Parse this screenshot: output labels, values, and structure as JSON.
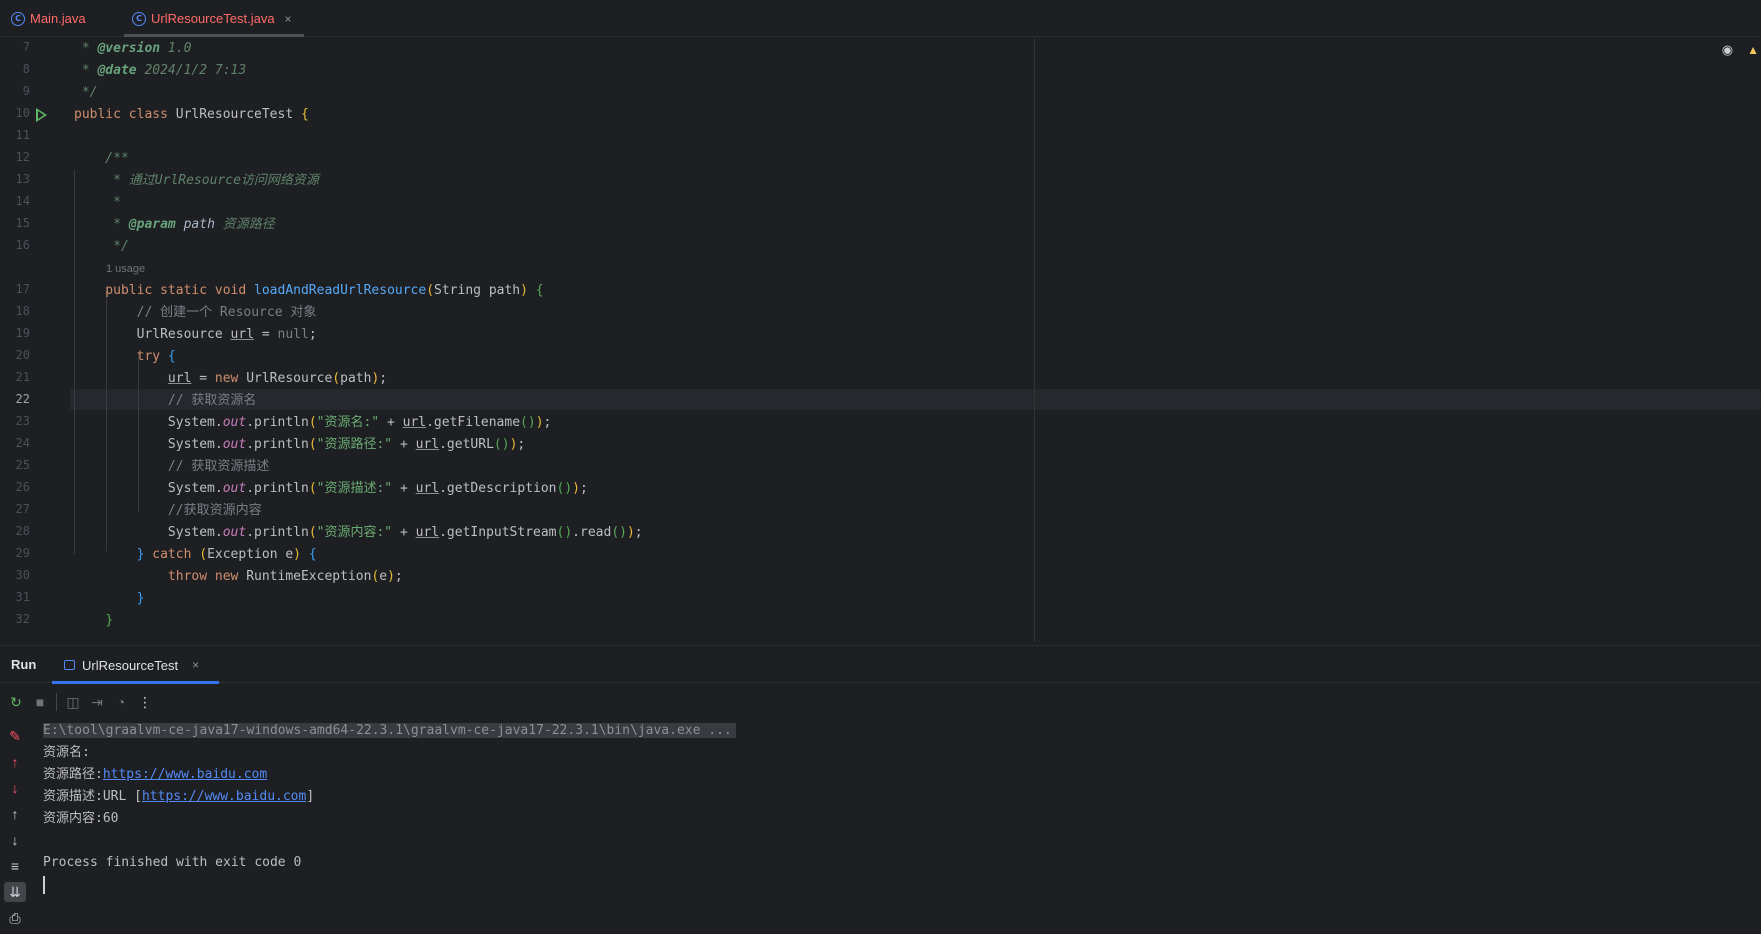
{
  "tabs": [
    {
      "label": "Main.java",
      "icon": "java-class-icon"
    },
    {
      "label": "UrlResourceTest.java",
      "icon": "java-class-icon",
      "close": "×"
    }
  ],
  "gutter": [
    "7",
    "8",
    "9",
    "10",
    "11",
    "12",
    "13",
    "14",
    "15",
    "16",
    "17",
    "18",
    "19",
    "20",
    "21",
    "22",
    "23",
    "24",
    "25",
    "26",
    "27",
    "28",
    "29",
    "30",
    "31",
    "32"
  ],
  "code": {
    "l7": {
      "a": " * ",
      "tag": "@version",
      "b": " 1.0"
    },
    "l8": {
      "a": " * ",
      "tag": "@date",
      "b": " 2024/1/2 7:13"
    },
    "l9": " */",
    "l10": {
      "kw": "public class ",
      "name": "UrlResourceTest ",
      "brace": "{"
    },
    "l12": "    /**",
    "l13": {
      "a": "     * ",
      "text": "通过UrlResource访问网络资源"
    },
    "l14": "     *",
    "l15": {
      "a": "     * ",
      "tag": "@param",
      "param": " path",
      "text": " 资源路径"
    },
    "l16": "     */",
    "usage": "1 usage",
    "l17": {
      "kw": "    public static void ",
      "fn": "loadAndReadUrlResource",
      "p1": "(",
      "args": "String path",
      "p2": ")",
      "sp": " ",
      "brace": "{"
    },
    "l18": "        // 创建一个 Resource 对象",
    "l19": {
      "a": "        UrlResource ",
      "var": "url",
      "b": " = ",
      "nul": "null",
      "c": ";"
    },
    "l20": {
      "kw": "        try ",
      "brace": "{"
    },
    "l21": {
      "ind": "            ",
      "var": "url",
      "b": " = ",
      "kw": "new ",
      "c": "UrlResource",
      "p1": "(",
      "d": "path",
      "p2": ")",
      "e": ";"
    },
    "l22": "            // 获取资源名",
    "l23": {
      "ind": "            System.",
      "out": "out",
      "m": ".println",
      "p1": "(",
      "str": "\"资源名:\"",
      "plus": " + ",
      "var": "url",
      "call": ".getFilename",
      "p2": "()",
      "p3": ")",
      "end": ";"
    },
    "l24": {
      "ind": "            System.",
      "out": "out",
      "m": ".println",
      "p1": "(",
      "str": "\"资源路径:\"",
      "plus": " + ",
      "var": "url",
      "call": ".getURL",
      "p2": "()",
      "p3": ")",
      "end": ";"
    },
    "l25": "            // 获取资源描述",
    "l26": {
      "ind": "            System.",
      "out": "out",
      "m": ".println",
      "p1": "(",
      "str": "\"资源描述:\"",
      "plus": " + ",
      "var": "url",
      "call": ".getDescription",
      "p2": "()",
      "p3": ")",
      "end": ";"
    },
    "l27": "            //获取资源内容",
    "l28": {
      "ind": "            System.",
      "out": "out",
      "m": ".println",
      "p1": "(",
      "str": "\"资源内容:\"",
      "plus": " + ",
      "var": "url",
      "call": ".getInputStream",
      "p2": "()",
      "call2": ".read",
      "p4": "()",
      "p3": ")",
      "end": ";"
    },
    "l29": {
      "ind": "        ",
      "b1": "}",
      "kw": " catch ",
      "p1": "(",
      "args": "Exception e",
      "p2": ")",
      "sp": " ",
      "b2": "{"
    },
    "l30": {
      "kw": "            throw new ",
      "c": "RuntimeException",
      "p1": "(",
      "d": "e",
      "p2": ")",
      "e": ";"
    },
    "l31": {
      "ind": "        ",
      "b": "}"
    },
    "l32": {
      "ind": "    ",
      "b": "}"
    }
  },
  "run": {
    "title": "Run",
    "tab": "UrlResourceTest",
    "close": "×"
  },
  "console": {
    "cmd": "E:\\tool\\graalvm-ce-java17-windows-amd64-22.3.1\\graalvm-ce-java17-22.3.1\\bin\\java.exe ...",
    "line1": "资源名:",
    "line2_label": "资源路径:",
    "line2_link": "https://www.baidu.com",
    "line3_label": "资源描述:URL [",
    "line3_link": "https://www.baidu.com",
    "line3_end": "]",
    "line4": "资源内容:60",
    "finish": "Process finished with exit code 0"
  },
  "colors": {
    "accent": "#3574f0",
    "background": "#1e1f22",
    "tab_text": "#ff6b68"
  }
}
